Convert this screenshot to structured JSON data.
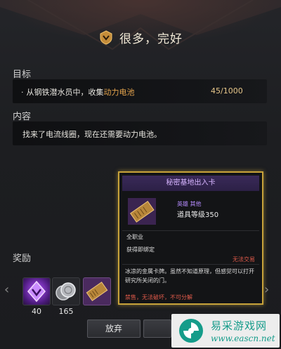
{
  "title": "很多，完好",
  "objective": {
    "label": "目标",
    "bullet": "·",
    "text_prefix": "从钢铁潜水员中，收集",
    "text_highlight": "动力电池",
    "progress": "45/1000"
  },
  "content": {
    "label": "内容",
    "text": "找来了电流线圈，现在还需要动力电池。"
  },
  "rewards": {
    "label": "奖励",
    "items": [
      {
        "icon": "purple-crystal-icon",
        "count": "40"
      },
      {
        "icon": "silver-coin-icon",
        "count": "165"
      },
      {
        "icon": "card-item-icon",
        "count": ""
      }
    ]
  },
  "buttons": {
    "abandon": "放弃"
  },
  "tooltip": {
    "title": "秘密基地出入卡",
    "grade": "英雄 其他",
    "level": "道具等级350",
    "class": "全职业",
    "bind": "获得即绑定",
    "trade": "无法交易",
    "description": "冰凉的金属卡牌。虽然不知道原理，但感觉可以打开研究所关闭的门。",
    "footer": "禁售，无法破坏，不可分解"
  },
  "watermark": {
    "name": "易采游戏网",
    "url": "www.eascn.net"
  },
  "colors": {
    "highlight": "#e6a54d",
    "tooltip_border": "#c7a23a",
    "tooltip_header": "#3a2a59",
    "warning": "#e05a4a",
    "watermark": "#159c8a"
  }
}
